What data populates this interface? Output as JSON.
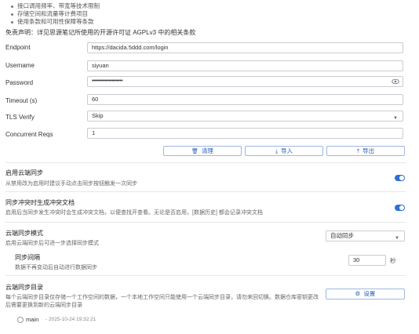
{
  "intro_bullets": [
    "接口调用频率、带宽等技术限制",
    "存储空间和流量等计费项目",
    "使用条款和可用性保障等条款"
  ],
  "disclaimer": "免责声明：详见思源笔记所使用的开源许可证 AGPLv3 中的相关条款",
  "form": {
    "endpoint": {
      "label": "Endpoint",
      "value": "https://dacida.5ddd.com/login"
    },
    "username": {
      "label": "Username",
      "value": "siyuan"
    },
    "password": {
      "label": "Password",
      "value": "••••••••••••••••••••"
    },
    "timeout": {
      "label": "Timeout (s)",
      "value": "60"
    },
    "tls_verify": {
      "label": "TLS Verify",
      "value": "Skip"
    },
    "concurrent": {
      "label": "Concurrent Reqs",
      "value": "1"
    }
  },
  "actions": {
    "clear": "清理",
    "import": "导入",
    "export": "导出"
  },
  "sync_enable": {
    "title": "启用云端同步",
    "desc": "从禁用改为启用时建议手动点击同步按钮触发一次同步",
    "on": true
  },
  "conflict": {
    "title": "同步冲突时生成冲突文档",
    "desc": "启用后当同步发生冲突时会生成冲突文档，以便查找开查看。无论是否启用，[数据历史] 都会记录冲突文档",
    "on": true
  },
  "sync_mode": {
    "title": "云端同步模式",
    "desc": "启用云端同步后可进一步选择同步模式",
    "selected": "自动同步"
  },
  "sync_interval": {
    "title": "同步间隔",
    "desc": "数据不再变动后自动进行数据同步",
    "value": "30",
    "unit": "秒"
  },
  "sync_dir": {
    "title": "云端同步目录",
    "desc_line1": "每个云端同步目录仅存储一个工作空间的数据，一个本地工作空间只能使用一个云端同步目录，请勿来回切换。数据仓库密钥更改",
    "desc_line2": "后需要更换到新的云端同步目录",
    "button": "设置",
    "entries": [
      {
        "name": "main",
        "meta": "- 2025-10-24 19:32:21"
      }
    ]
  }
}
